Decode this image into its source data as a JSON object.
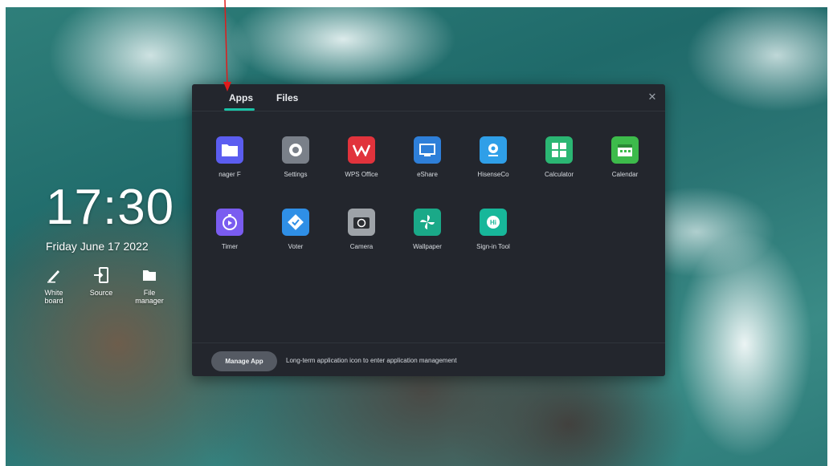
{
  "clock": {
    "time": "17:30",
    "date": "Friday June 17 2022"
  },
  "shortcuts": [
    {
      "label": "White board",
      "icon": "pen-icon"
    },
    {
      "label": "Source",
      "icon": "source-input-icon"
    },
    {
      "label": "File manager",
      "icon": "folder-icon"
    }
  ],
  "dialog": {
    "tabs": [
      {
        "label": "Apps",
        "active": true
      },
      {
        "label": "Files",
        "active": false
      }
    ],
    "close_icon": "close-icon",
    "apps": [
      {
        "label": "nager F",
        "icon": "folder-icon",
        "color": "#5b5df0"
      },
      {
        "label": "Settings",
        "icon": "gear-icon",
        "color": "#7a8089"
      },
      {
        "label": "WPS Office",
        "icon": "wps-icon",
        "color": "#e1333c"
      },
      {
        "label": "eShare",
        "icon": "screen-share-icon",
        "color": "#2e7fd9"
      },
      {
        "label": "HisenseCo",
        "icon": "webcam-icon",
        "color": "#2f9fe8"
      },
      {
        "label": "Calculator",
        "icon": "calculator-icon",
        "color": "#2bb673"
      },
      {
        "label": "Calendar",
        "icon": "calendar-icon",
        "color": "#3dbb4b"
      },
      {
        "label": "Timer",
        "icon": "timer-icon",
        "color": "#7a5cf0"
      },
      {
        "label": "Voter",
        "icon": "vote-icon",
        "color": "#2f8fe6"
      },
      {
        "label": "Camera",
        "icon": "camera-icon",
        "color": "#9ea3a8"
      },
      {
        "label": "Wallpaper",
        "icon": "pinwheel-icon",
        "color": "#1aa988"
      },
      {
        "label": "Sign-in Tool",
        "icon": "sign-in-icon",
        "color": "#17b79a"
      }
    ],
    "footer": {
      "manage_button": "Manage App",
      "hint": "Long-term application icon to enter application management"
    }
  },
  "colors": {
    "accent": "#19c2a6",
    "dialog_bg": "#23262d",
    "annotation": "#e01b1b"
  }
}
